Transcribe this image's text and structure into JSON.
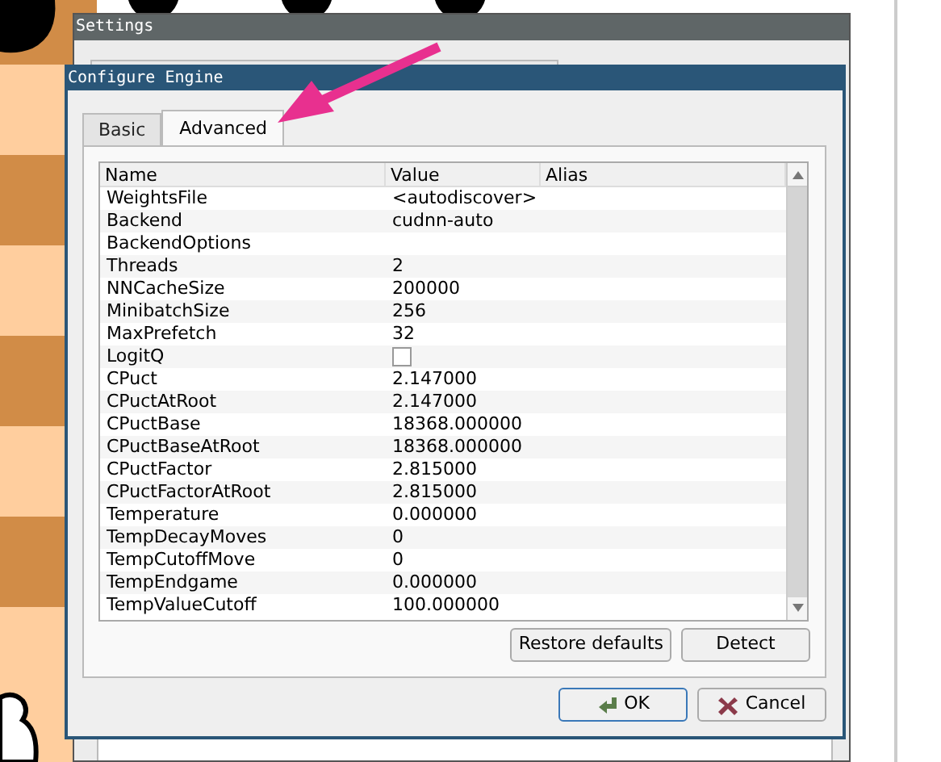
{
  "settings_window": {
    "title": "Settings"
  },
  "dialog": {
    "title": "Configure Engine",
    "tabs": [
      {
        "label": "Basic",
        "selected": false
      },
      {
        "label": "Advanced",
        "selected": true
      }
    ],
    "table": {
      "columns": [
        "Name",
        "Value",
        "Alias"
      ],
      "rows": [
        {
          "name": "WeightsFile",
          "kind": "text",
          "value": "<autodiscover>"
        },
        {
          "name": "Backend",
          "kind": "text",
          "value": "cudnn-auto"
        },
        {
          "name": "BackendOptions",
          "kind": "text"
        },
        {
          "name": "Threads",
          "kind": "text",
          "value": "2"
        },
        {
          "name": "NNCacheSize",
          "kind": "text",
          "value": "200000"
        },
        {
          "name": "MinibatchSize",
          "kind": "text",
          "value": "256"
        },
        {
          "name": "MaxPrefetch",
          "kind": "text",
          "value": "32"
        },
        {
          "name": "LogitQ",
          "kind": "checkbox",
          "checked": false
        },
        {
          "name": "CPuct",
          "kind": "text",
          "value": "2.147000"
        },
        {
          "name": "CPuctAtRoot",
          "kind": "text",
          "value": "2.147000"
        },
        {
          "name": "CPuctBase",
          "kind": "text",
          "value": "18368.000000"
        },
        {
          "name": "CPuctBaseAtRoot",
          "kind": "text",
          "value": "18368.000000"
        },
        {
          "name": "CPuctFactor",
          "kind": "text",
          "value": "2.815000"
        },
        {
          "name": "CPuctFactorAtRoot",
          "kind": "text",
          "value": "2.815000"
        },
        {
          "name": "Temperature",
          "kind": "text",
          "value": "0.000000"
        },
        {
          "name": "TempDecayMoves",
          "kind": "text",
          "value": "0"
        },
        {
          "name": "TempCutoffMove",
          "kind": "text",
          "value": "0"
        },
        {
          "name": "TempEndgame",
          "kind": "text",
          "value": "0.000000"
        },
        {
          "name": "TempValueCutoff",
          "kind": "text",
          "value": "100.000000"
        }
      ]
    },
    "panel_buttons": [
      "Restore defaults",
      "Detect"
    ],
    "buttons": [
      {
        "label": "OK",
        "kind": "ok"
      },
      {
        "label": "Cancel",
        "kind": "cancel"
      }
    ]
  }
}
